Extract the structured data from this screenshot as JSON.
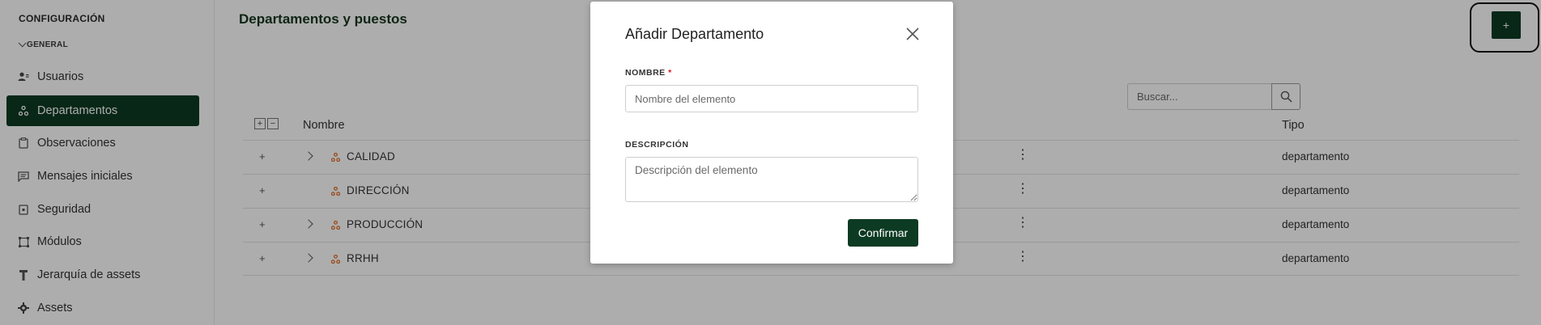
{
  "sidebar": {
    "section_title": "CONFIGURACIÓN",
    "group_label": "GENERAL",
    "items": [
      {
        "label": "Usuarios",
        "icon": "users-icon"
      },
      {
        "label": "Departamentos",
        "icon": "department-icon",
        "active": true
      },
      {
        "label": "Observaciones",
        "icon": "clipboard-icon"
      },
      {
        "label": "Mensajes iniciales",
        "icon": "message-icon"
      },
      {
        "label": "Seguridad",
        "icon": "security-icon"
      },
      {
        "label": "Módulos",
        "icon": "modules-icon"
      },
      {
        "label": "Jerarquía de assets",
        "icon": "hierarchy-icon"
      },
      {
        "label": "Assets",
        "icon": "gear-icon"
      }
    ]
  },
  "header": {
    "title": "Departamentos y puestos",
    "add_label": "+"
  },
  "search": {
    "placeholder": "Buscar..."
  },
  "table": {
    "columns": [
      "Nombre",
      "Tipo"
    ],
    "expand_all": "+",
    "collapse_all": "−",
    "rows": [
      {
        "name": "CALIDAD",
        "type": "departamento",
        "has_children": true
      },
      {
        "name": "DIRECCIÓN",
        "type": "departamento",
        "has_children": false
      },
      {
        "name": "PRODUCCIÓN",
        "type": "departamento",
        "has_children": true
      },
      {
        "name": "RRHH",
        "type": "departamento",
        "has_children": true
      }
    ],
    "row_add_label": "+",
    "row_menu_label": "⋮"
  },
  "modal": {
    "title": "Añadir Departamento",
    "name_label": "NOMBRE",
    "required_mark": "*",
    "name_placeholder": "Nombre del elemento",
    "description_label": "DESCRIPCIÓN",
    "description_placeholder": "Descripción del elemento",
    "confirm_label": "Confirmar"
  },
  "colors": {
    "brand": "#0c3a22",
    "department_icon": "#e0702c"
  }
}
